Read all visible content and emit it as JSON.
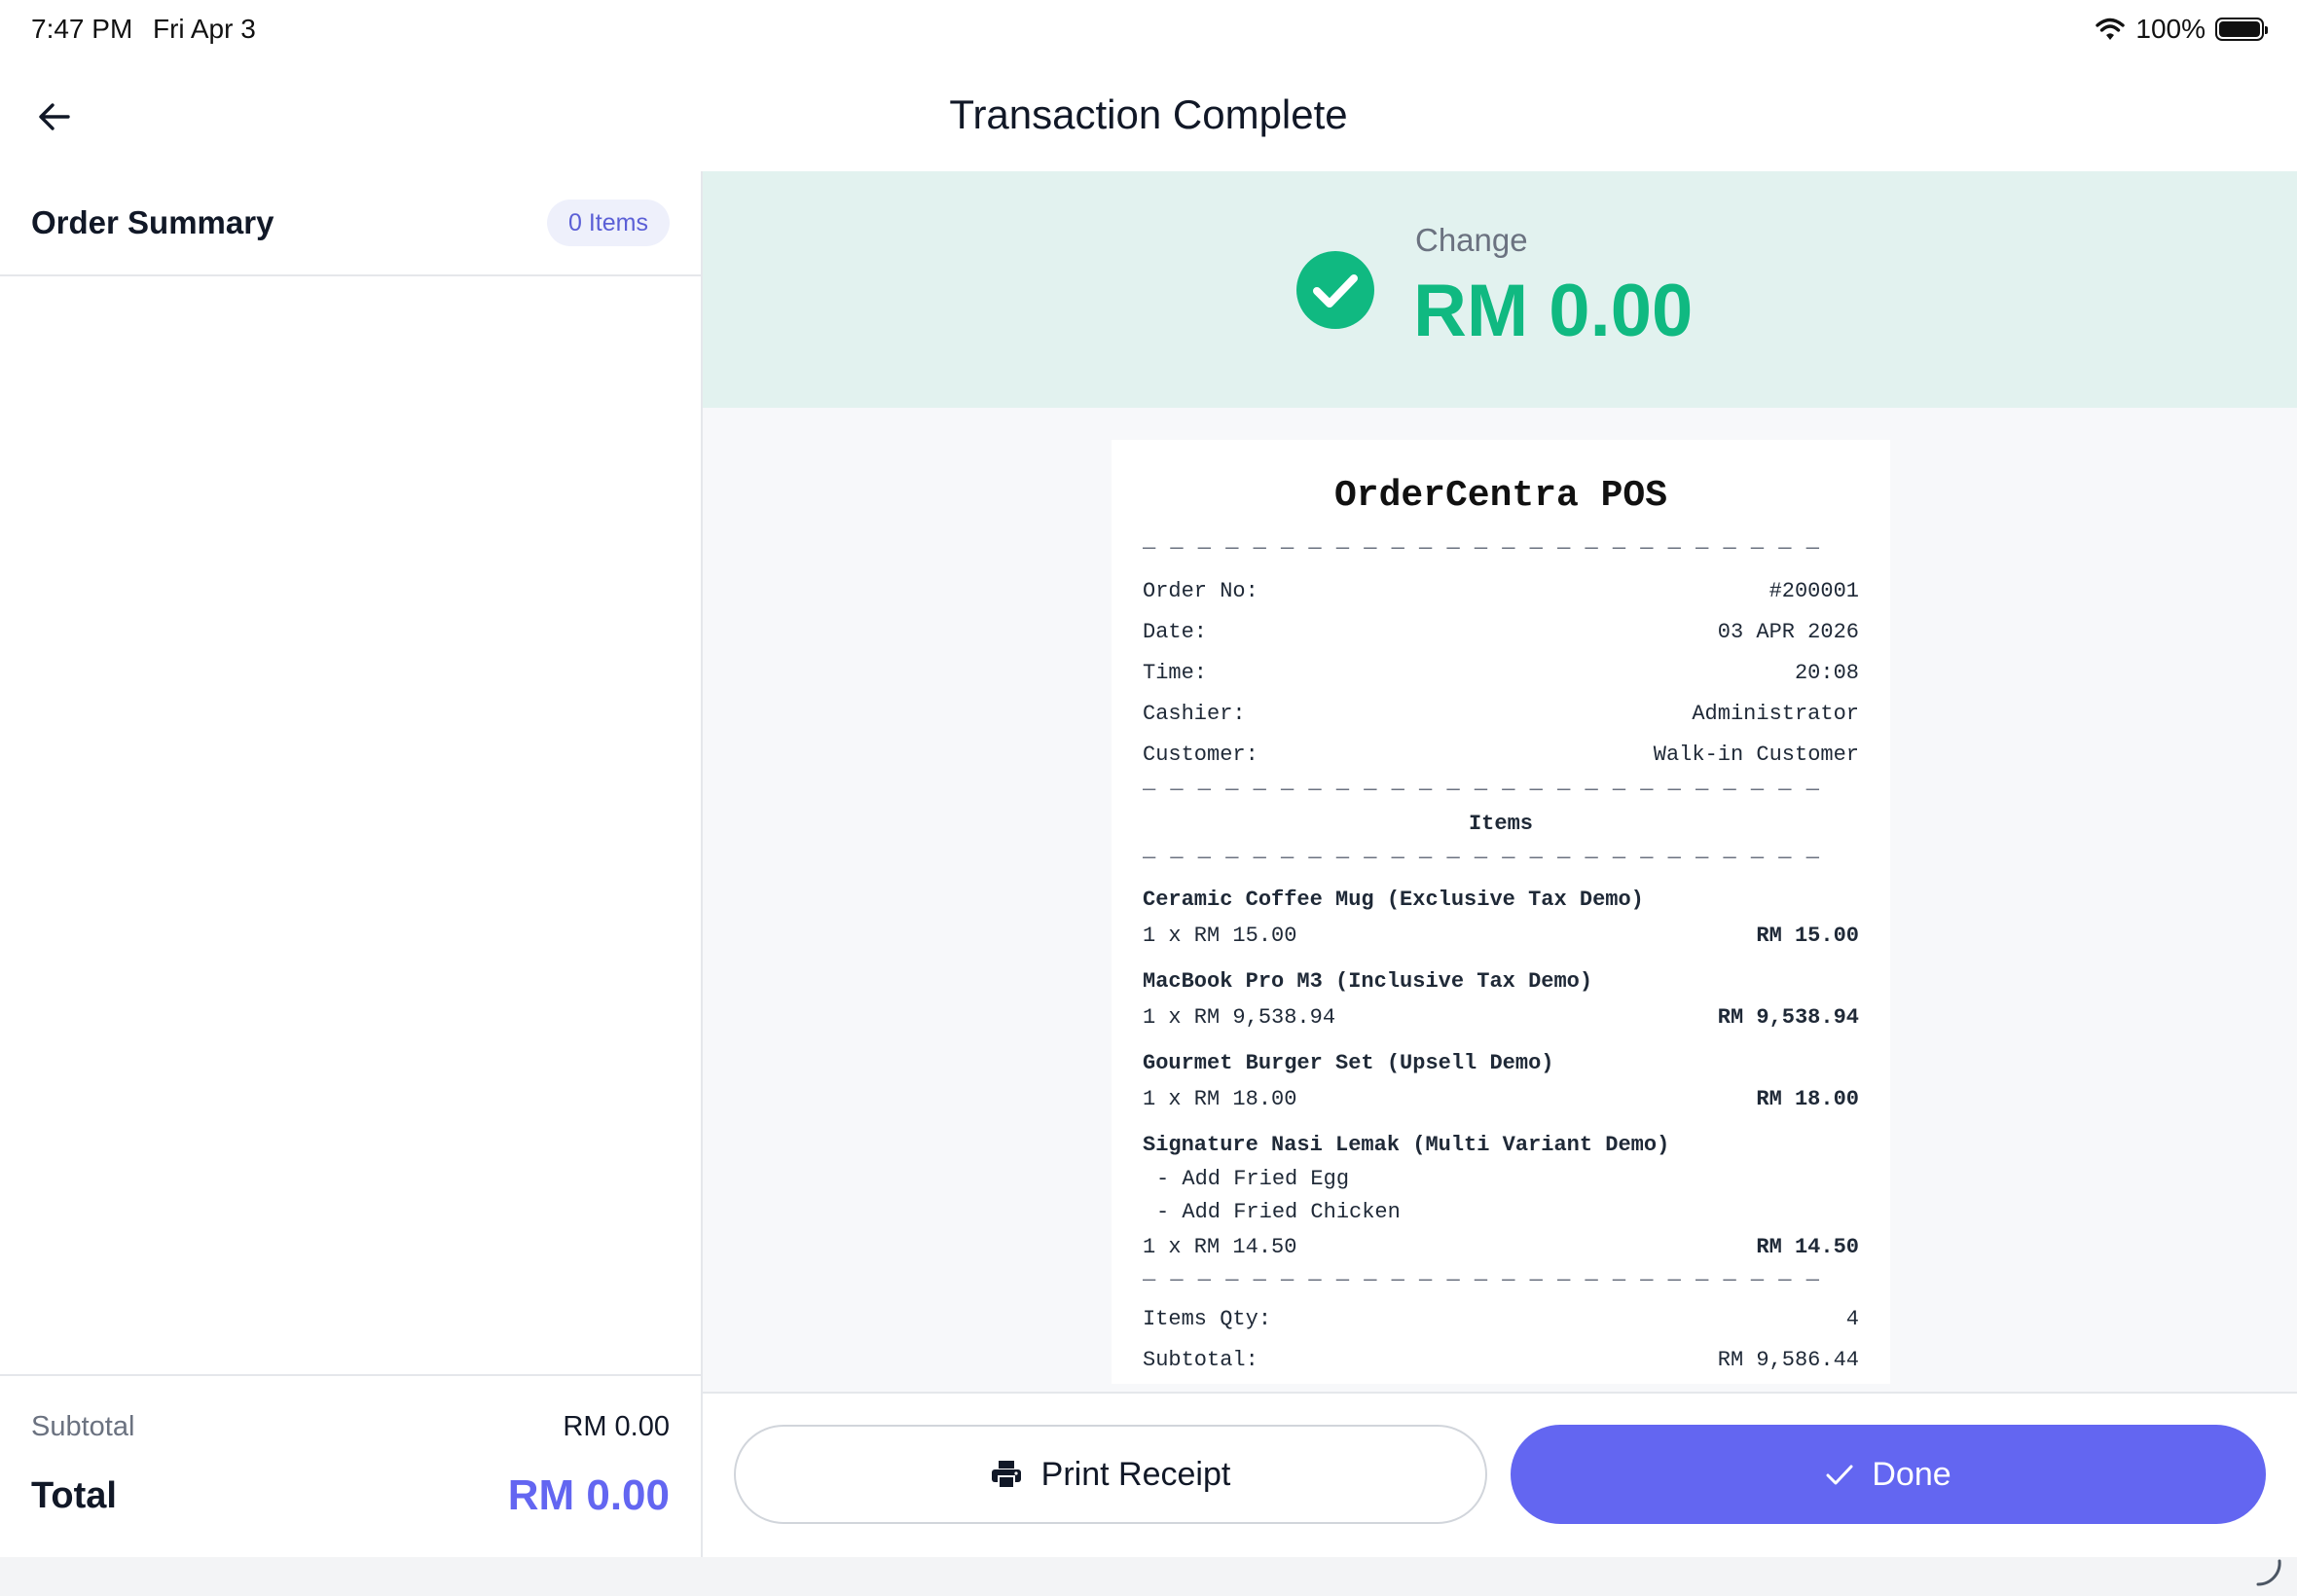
{
  "status_bar": {
    "time": "7:47 PM",
    "date": "Fri Apr 3",
    "battery": "100%"
  },
  "header": {
    "title": "Transaction Complete"
  },
  "order_summary": {
    "title": "Order Summary",
    "items_badge": "0 Items",
    "subtotal_label": "Subtotal",
    "subtotal_value": "RM 0.00",
    "total_label": "Total",
    "total_value": "RM 0.00"
  },
  "change": {
    "label": "Change",
    "amount": "RM 0.00"
  },
  "receipt": {
    "store_name": "OrderCentra POS",
    "dashes": "— — — — — — — — — — — — — — — — — — — — — — — — —",
    "info": [
      {
        "label": "Order No:",
        "value": "#200001"
      },
      {
        "label": "Date:",
        "value": "03 APR 2026"
      },
      {
        "label": "Time:",
        "value": "20:08"
      },
      {
        "label": "Cashier:",
        "value": "Administrator"
      },
      {
        "label": "Customer:",
        "value": "Walk-in Customer"
      }
    ],
    "items_heading": "Items",
    "items": [
      {
        "name": "Ceramic Coffee Mug (Exclusive Tax Demo)",
        "modifiers": [],
        "qty_price": "1 x RM 15.00",
        "line_total": "RM 15.00"
      },
      {
        "name": "MacBook Pro M3 (Inclusive Tax Demo)",
        "modifiers": [],
        "qty_price": "1 x RM 9,538.94",
        "line_total": "RM 9,538.94"
      },
      {
        "name": "Gourmet Burger Set (Upsell Demo)",
        "modifiers": [],
        "qty_price": "1 x RM 18.00",
        "line_total": "RM 18.00"
      },
      {
        "name": "Signature Nasi Lemak (Multi Variant Demo)",
        "modifiers": [
          "- Add Fried Egg",
          "- Add Fried Chicken"
        ],
        "qty_price": "1 x RM 14.50",
        "line_total": "RM 14.50"
      }
    ],
    "totals": [
      {
        "label": "Items Qty:",
        "value": "4"
      },
      {
        "label": "Subtotal:",
        "value": "RM 9,586.44"
      }
    ]
  },
  "actions": {
    "print_label": "Print Receipt",
    "done_label": "Done"
  },
  "colors": {
    "accent": "#6366f1",
    "success": "#10b981",
    "banner": "#e2f2ef"
  }
}
